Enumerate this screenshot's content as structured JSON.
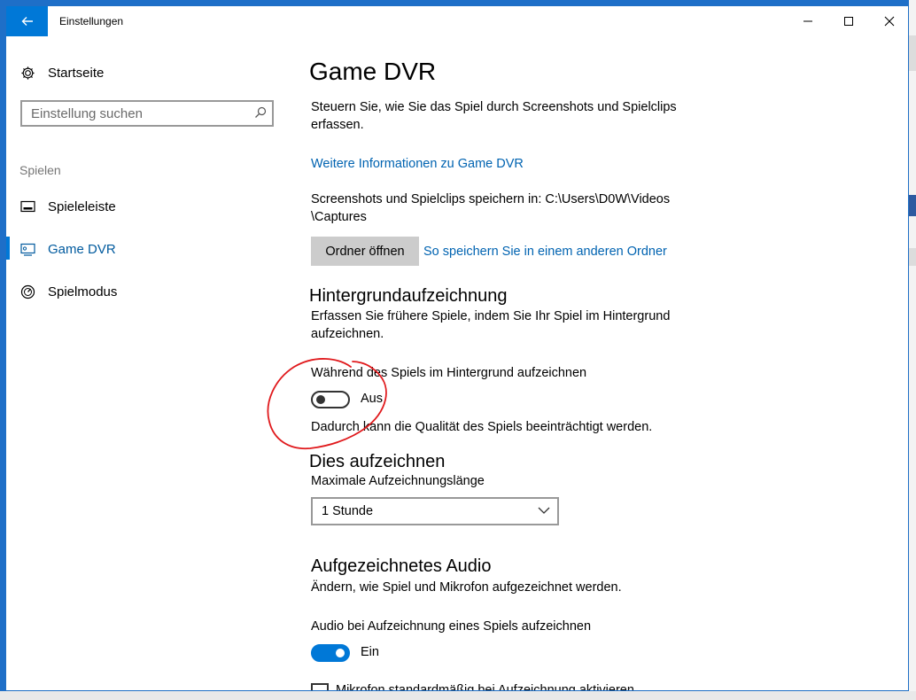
{
  "window": {
    "title": "Einstellungen"
  },
  "sidebar": {
    "home_label": "Startseite",
    "search_placeholder": "Einstellung suchen",
    "section_label": "Spielen",
    "items": [
      {
        "label": "Spieleleiste",
        "icon": "game-bar-icon",
        "active": false
      },
      {
        "label": "Game DVR",
        "icon": "game-dvr-icon",
        "active": true
      },
      {
        "label": "Spielmodus",
        "icon": "game-mode-icon",
        "active": false
      }
    ]
  },
  "main": {
    "title": "Game DVR",
    "description": "Steuern Sie, wie Sie das Spiel durch Screenshots und Spielclips erfassen.",
    "info_link": "Weitere Informationen zu Game DVR",
    "save_path": "Screenshots und Spielclips speichern in: C:\\Users\\D0W\\Videos\\Captures",
    "open_folder_button": "Ordner öffnen",
    "other_folder_link": "So speichern Sie in einem anderen Ordner",
    "background": {
      "heading": "Hintergrundaufzeichnung",
      "description": "Erfassen Sie frühere Spiele, indem Sie Ihr Spiel im Hintergrund aufzeichnen.",
      "toggle_label": "Während des Spiels im Hintergrund aufzeichnen",
      "toggle_state": "Aus",
      "toggle_on": false,
      "note": "Dadurch kann die Qualität des Spiels beeinträchtigt werden."
    },
    "record_this": {
      "heading": "Dies aufzeichnen",
      "max_length_label": "Maximale Aufzeichnungslänge",
      "max_length_value": "1 Stunde"
    },
    "audio": {
      "heading": "Aufgezeichnetes Audio",
      "description": "Ändern, wie Spiel und Mikrofon aufgezeichnet werden.",
      "toggle_label": "Audio bei Aufzeichnung eines Spiels aufzeichnen",
      "toggle_state": "Ein",
      "toggle_on": true,
      "mic_checkbox_label": "Mikrofon standardmäßig bei Aufzeichnung aktivieren"
    }
  },
  "colors": {
    "accent": "#0078d7",
    "link": "#0063b1",
    "annotation": "#e0191c"
  }
}
